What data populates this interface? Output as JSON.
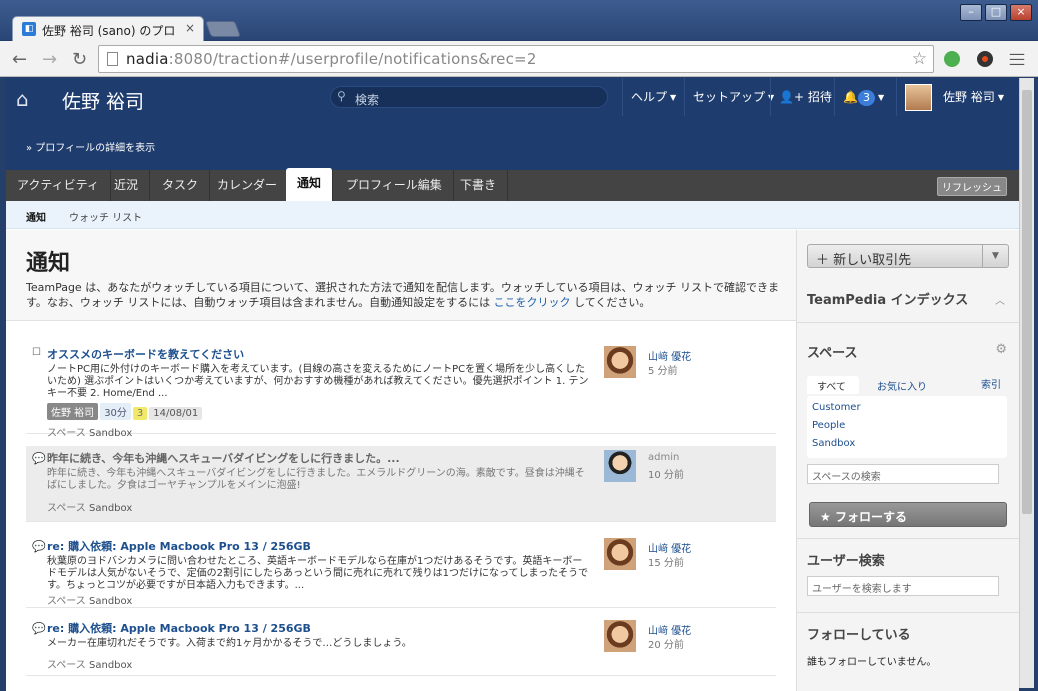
{
  "browser": {
    "tab_title": "佐野 裕司 (sano) のプロ",
    "tab_favicon": "teampage-favicon",
    "url_host": "nadia",
    "url_rest": ":8080/traction#/userprofile/notifications&rec=2"
  },
  "header": {
    "user_name": "佐野 裕司",
    "search_placeholder": "検索",
    "menu_help": "ヘルプ",
    "menu_setup": "セットアップ",
    "menu_invite": "招待",
    "notification_count": "3",
    "menu_user": "佐野 裕司",
    "profile_link": "» プロフィールの詳細を表示"
  },
  "nav_tabs": [
    "アクティビティ",
    "近況",
    "タスク",
    "カレンダー",
    "通知",
    "プロフィール編集",
    "下書き"
  ],
  "refresh_label": "リフレッシュ",
  "sub_tabs": {
    "notifications": "通知",
    "watch_list": "ウォッチ リスト"
  },
  "intro": {
    "title": "通知",
    "text_before": "TeamPage は、あなたがウォッチしている項目について、選択された方法で通知を配信します。ウォッチしている項目は、ウォッチ リストで確認できます。なお、ウォッチ リストには、自動ウォッチ項目は含まれません。自動通知設定をするには ",
    "link": "ここをクリック",
    "text_after": " してください。"
  },
  "items": [
    {
      "title": "オススメのキーボードを教えてください",
      "body": "ノートPC用に外付けのキーボード購入を考えています。(目線の高さを変えるためにノートPCを置く場所を少し高くしたいため) 選ぶポイントはいくつか考えていますが、何かおすすめ機種があれば教えてください。優先選択ポイント 1. テンキー不要 2. Home/End ...",
      "tags": [
        "佐野 裕司",
        "30分",
        "3",
        "14/08/01"
      ],
      "space_label": "スペース",
      "space": "Sandbox",
      "author": "山﨑 優花",
      "time": "5 分前"
    },
    {
      "title": "昨年に続き、今年も沖縄へスキューバダイビングをしに行きました。...",
      "body": "昨年に続き、今年も沖縄へスキューバダイビングをしに行きました。エメラルドグリーンの海。素敵です。昼食は沖縄そばにしました。夕食はゴーヤチャンプルをメインに泡盛!",
      "space_label": "スペース",
      "space": "Sandbox",
      "author": "admin",
      "time": "10 分前"
    },
    {
      "title": "re: 購入依頼: Apple Macbook Pro 13 / 256GB",
      "body": "秋葉原のヨドバシカメラに問い合わせたところ、英語キーボードモデルなら在庫が1つだけあるそうです。英語キーボードモデルは人気がないそうで、定価の2割引にしたらあっという間に売れに売れて残りは1つだけになってしまったそうです。ちょっとコツが必要ですが日本語入力もできます。...",
      "space_label": "スペース",
      "space": "Sandbox",
      "author": "山﨑 優花",
      "time": "15 分前"
    },
    {
      "title": "re: 購入依頼: Apple Macbook Pro 13 / 256GB",
      "body": "メーカー在庫切れだそうです。入荷まで約1ヶ月かかるそうで…どうしましょう。",
      "space_label": "スペース",
      "space": "Sandbox",
      "author": "山﨑 優花",
      "time": "20 分前"
    }
  ],
  "sidebar": {
    "new_button": "新しい取引先",
    "teampedia": "TeamPedia インデックス",
    "spaces_title": "スペース",
    "spaces_tabs": {
      "all": "すべて",
      "favorites": "お気に入り",
      "index": "索引"
    },
    "spaces": [
      "Customer",
      "People",
      "Sandbox"
    ],
    "space_search_placeholder": "スペースの検索",
    "follow_button": "フォローする",
    "user_search_title": "ユーザー検索",
    "user_search_placeholder": "ユーザーを検索します",
    "following_title": "フォローしている",
    "following_empty": "誰もフォローしていません。"
  },
  "colors": {
    "header_bg": "#1e3c6e",
    "tab_bar": "#444444",
    "link": "#1d4f8e",
    "accent": "#3b7dd8"
  }
}
